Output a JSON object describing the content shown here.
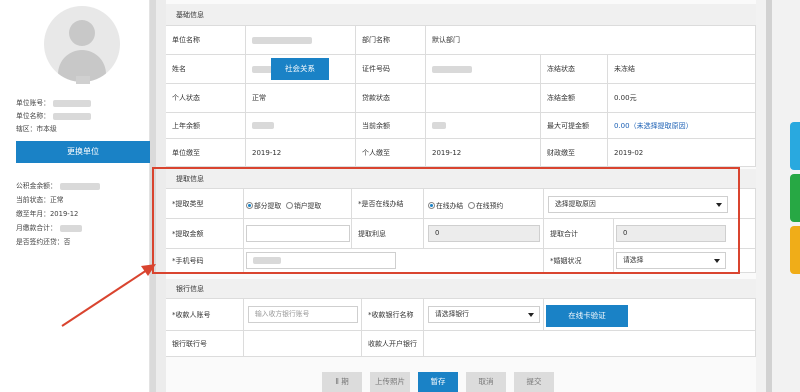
{
  "left_panel": {
    "unit_account_label": "单位账号：",
    "unit_name_label": "单位名称：",
    "jurisdiction": "辖区：市本级",
    "change_unit_button": "更换单位",
    "fund_account_label": "公积金余额：",
    "current_status": "当前状态：正常",
    "paid_to": "缴至年月：2019-12",
    "monthly_total_label": "月缴款合计：",
    "signed_repay": "是否签约还贷：否"
  },
  "basic": {
    "title": "基础信息",
    "unit_name_label": "单位名称",
    "dept_name_label": "部门名称",
    "dept_name_value": "默认部门",
    "name_label": "姓名",
    "social_button": "社会关系",
    "id_no_label": "证件号码",
    "freeze_status_label": "冻结状态",
    "freeze_status_value": "未冻结",
    "personal_status_label": "个人状态",
    "personal_status_value": "正常",
    "loan_status_label": "贷款状态",
    "frozen_amount_label": "冻结金额",
    "frozen_amount_value": "0.00元",
    "last_year_balance_label": "上年余额",
    "current_balance_label": "当前余额",
    "max_withdraw_label": "最大可提金额",
    "max_withdraw_value": "0.00（未选择提取原因）",
    "unit_paid_to_label": "单位缴至",
    "unit_paid_to_value": "2019-12",
    "personal_paid_to_label": "个人缴至",
    "personal_paid_to_value": "2019-12",
    "fiscal_paid_to_label": "财政缴至",
    "fiscal_paid_to_value": "2019-02"
  },
  "withdraw": {
    "title": "提取信息",
    "type_label": "*提取类型",
    "type_opt1": "部分提取",
    "type_opt2": "销户提取",
    "online_label": "*是否在线办结",
    "online_opt1": "在线办结",
    "online_opt2": "在线预约",
    "reason_select": "选择提取原因",
    "amount_label": "*提取金额",
    "interest_label": "提取利息",
    "interest_value": "0",
    "total_label": "提取合计",
    "total_value": "0",
    "phone_label": "*手机号码",
    "marital_label": "*婚姻状况",
    "marital_select": "请选择"
  },
  "bank": {
    "title": "银行信息",
    "payee_account_label": "*收款人账号",
    "payee_account_placeholder": "输入收方银行账号",
    "payee_bank_label": "*收款银行名称",
    "payee_bank_select": "请选择银行",
    "verify_button": "在线卡验证",
    "bank_no_label": "银行联行号",
    "payee_open_bank_label": "收款人开户银行"
  },
  "actions": {
    "b1": "Ⅱ 期",
    "b2": "上传照片",
    "b3": "暂存",
    "b4": "取消",
    "b5": "提交"
  },
  "colors": {
    "accent": "#1a82c6",
    "highlight": "#d9442f"
  }
}
